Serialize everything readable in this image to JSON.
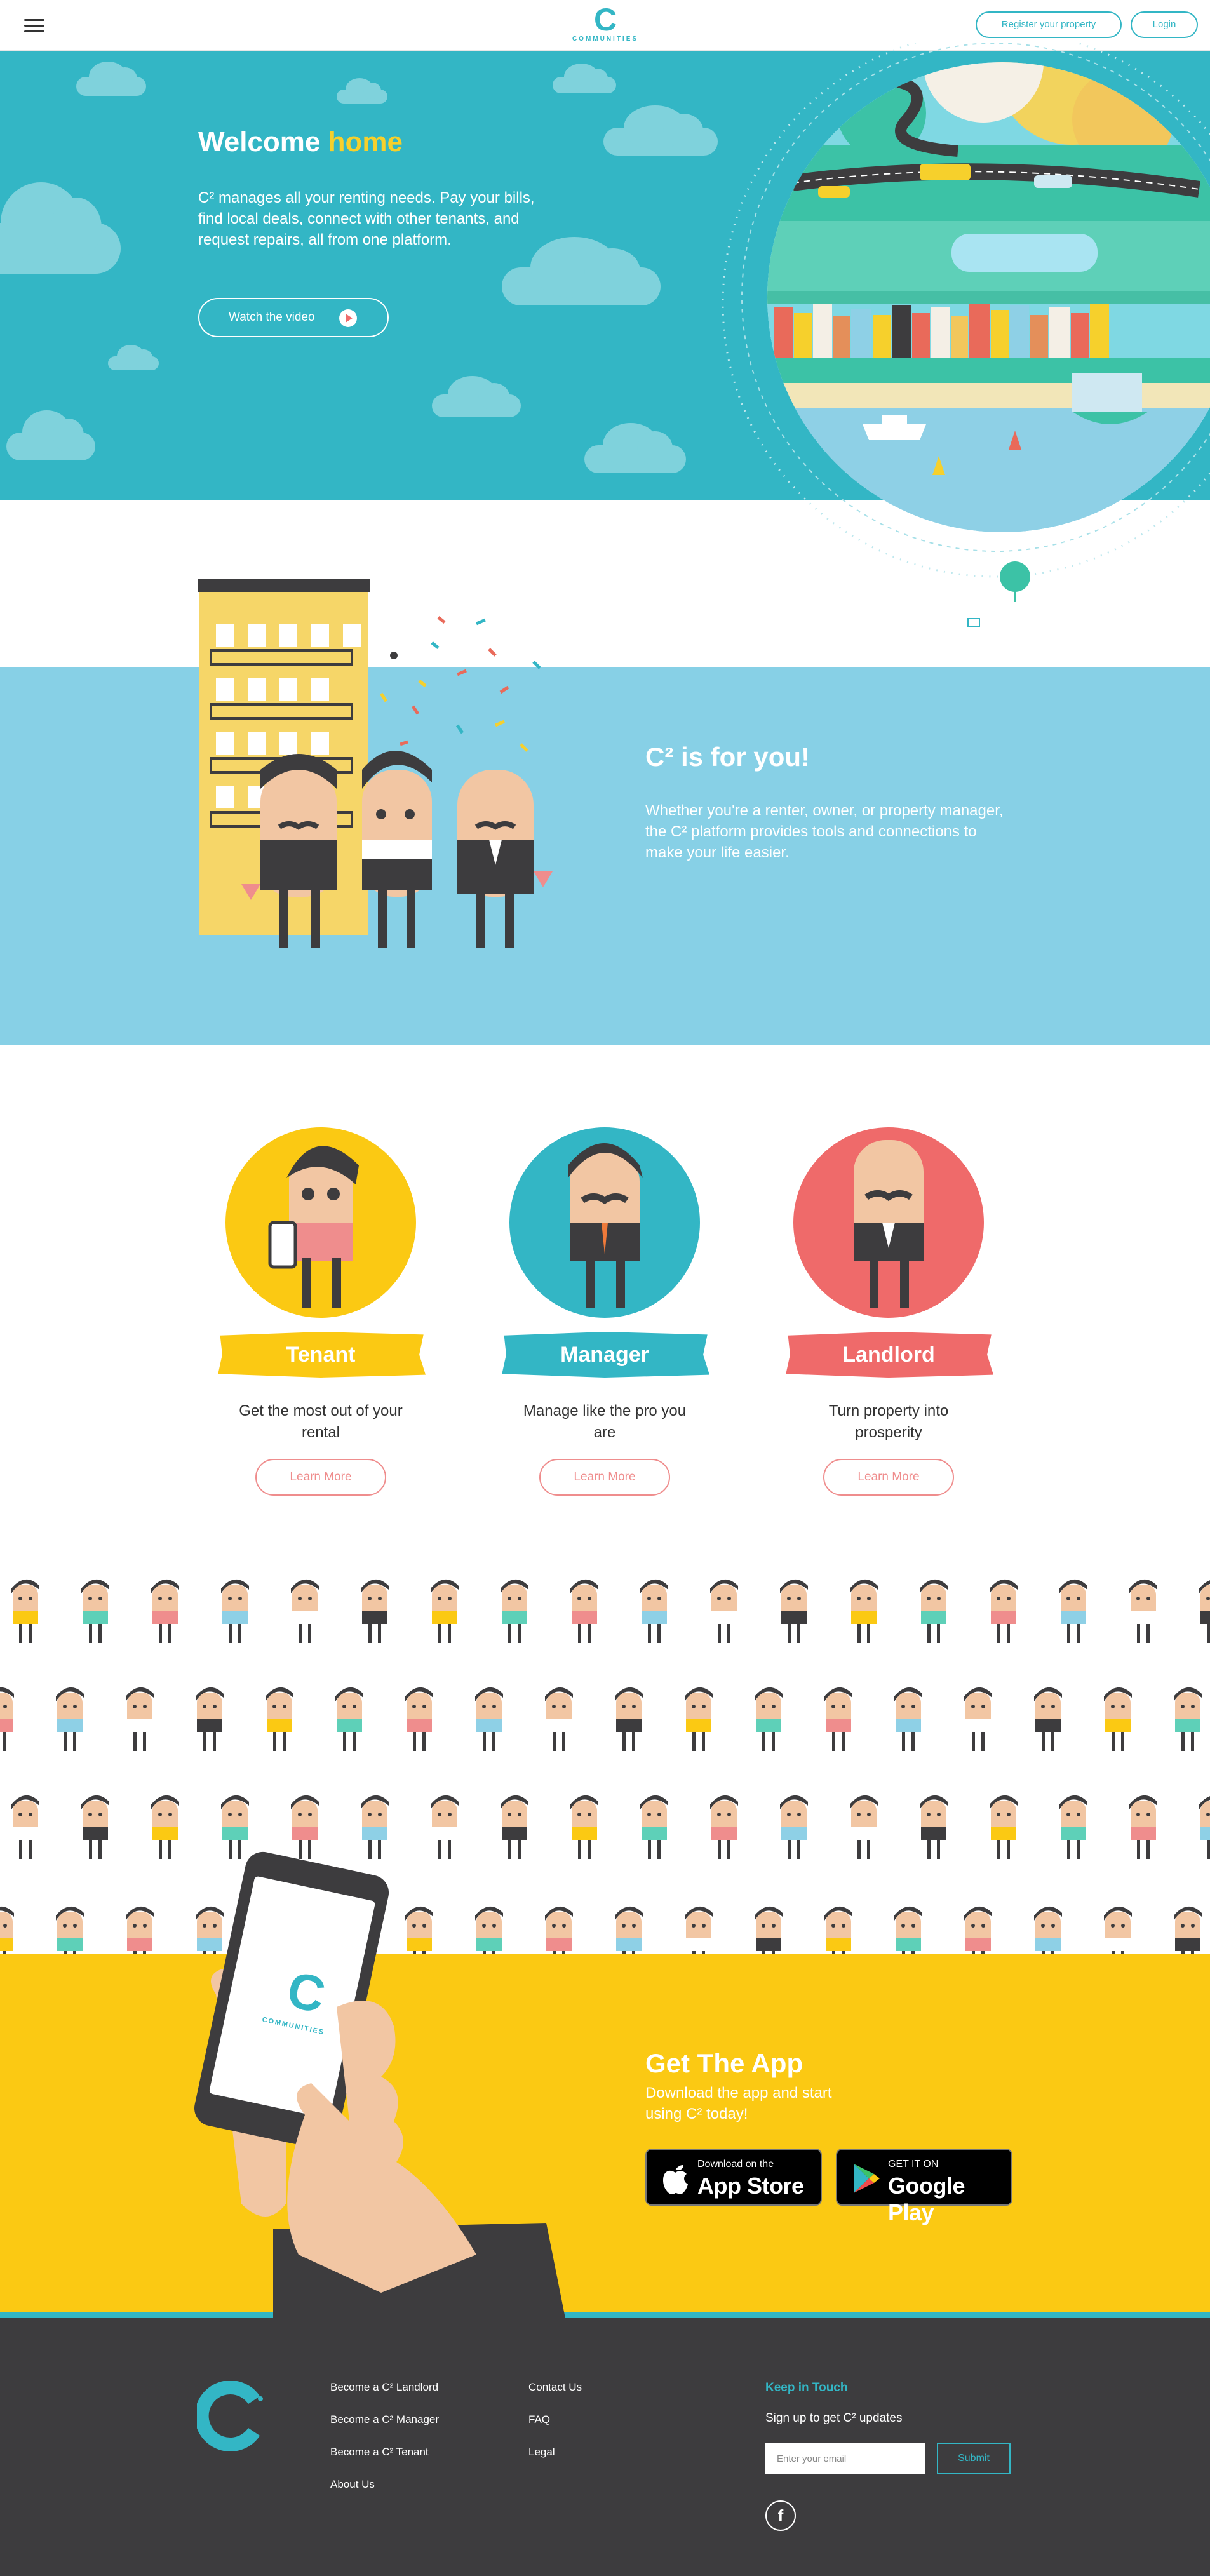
{
  "header": {
    "logo_letter": "C",
    "logo_word": "COMMUNITIES",
    "register_label": "Register your property",
    "login_label": "Login"
  },
  "hero": {
    "title_main": "Welcome",
    "title_accent": "home",
    "text": "C² manages all your renting needs. Pay your bills, find local deals, connect with other tenants, and request repairs, all from one platform.",
    "video_label": "Watch the video"
  },
  "foryou": {
    "title": "C² is for you!",
    "text": "Whether you're a renter, owner, or property manager, the C² platform provides tools and connections to make your life easier."
  },
  "roles": [
    {
      "label": "Tenant",
      "desc": "Get the most out of your rental",
      "button": "Learn More",
      "color": "#fbc913",
      "badge_color": "#fbc913"
    },
    {
      "label": "Manager",
      "desc": "Manage like the pro you are",
      "button": "Learn More",
      "color": "#33b6c5",
      "badge_color": "#33b6c5"
    },
    {
      "label": "Landlord",
      "desc": "Turn property into prosperity",
      "button": "Learn More",
      "color": "#ef6a6a",
      "badge_color": "#ef6a6a"
    }
  ],
  "app": {
    "title": "Get The App",
    "text": "Download the app and start using C² today!",
    "apple_small": "Download on the",
    "apple_big": "App Store",
    "google_small": "GET IT ON",
    "google_big": "Google Play",
    "phone_logo_word": "COMMUNITIES"
  },
  "footer": {
    "col1": [
      "Become a C² Landlord",
      "Become a C² Manager",
      "Become a C² Tenant",
      "About Us"
    ],
    "col2": [
      "Contact Us",
      "FAQ",
      "Legal"
    ],
    "keep_title": "Keep in Touch",
    "signup_text": "Sign up to get C² updates",
    "email_placeholder": "Enter your email",
    "submit_label": "Submit",
    "facebook_glyph": "f"
  },
  "colors": {
    "teal": "#33b6c5",
    "yellow": "#fbc913",
    "coral": "#ef6a6a",
    "sky": "#87d0e6",
    "footer": "#3d3c3e"
  }
}
